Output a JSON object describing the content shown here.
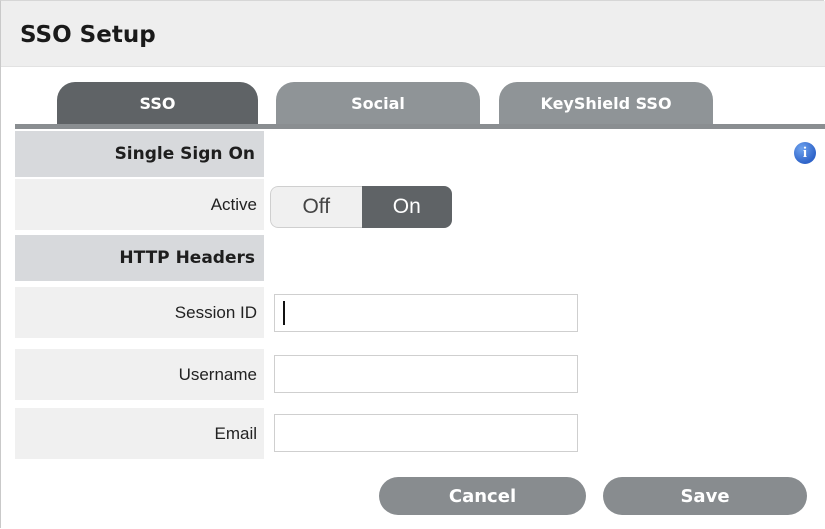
{
  "header": {
    "title": "SSO Setup"
  },
  "tabs": [
    {
      "label": "SSO",
      "active": true
    },
    {
      "label": "Social",
      "active": false
    },
    {
      "label": "KeyShield SSO",
      "active": false
    }
  ],
  "sections": {
    "single_sign_on": "Single Sign On",
    "http_headers": "HTTP Headers"
  },
  "fields": {
    "active": {
      "label": "Active",
      "options": [
        "Off",
        "On"
      ],
      "selected": "On"
    },
    "session_id": {
      "label": "Session ID",
      "value": ""
    },
    "username": {
      "label": "Username",
      "value": ""
    },
    "email": {
      "label": "Email",
      "value": ""
    }
  },
  "info_icon": {
    "icon": "info-icon",
    "glyph": "i",
    "color": "#2f64c9"
  },
  "buttons": {
    "cancel": "Cancel",
    "save": "Save"
  },
  "colors": {
    "accent_dark": "#5f6366",
    "tab_inactive": "#8f9497",
    "section_bg": "#d7d9dc"
  }
}
